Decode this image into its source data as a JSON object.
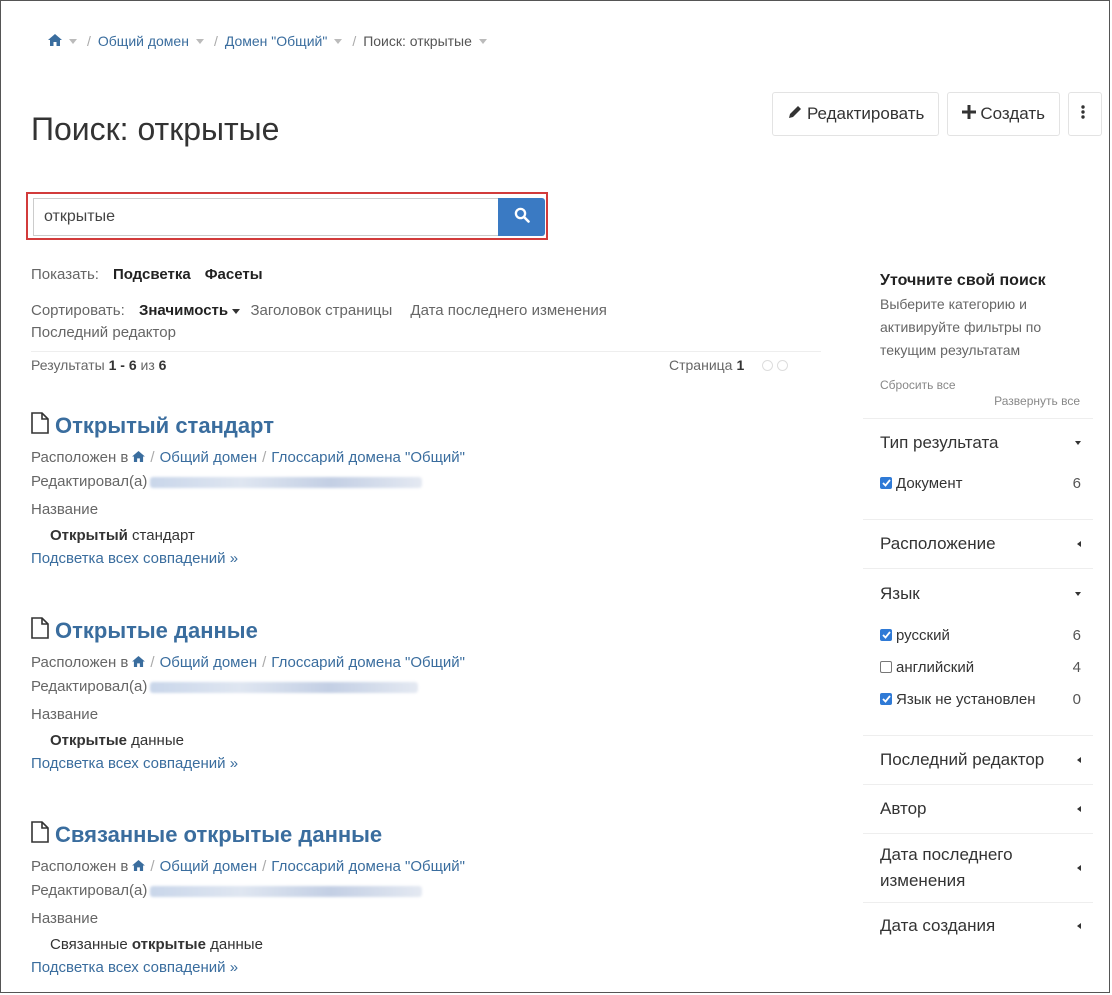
{
  "breadcrumb": {
    "home_icon": "home-icon",
    "items": [
      "Общий домен",
      "Домен \"Общий\""
    ],
    "current": "Поиск: открытые"
  },
  "page": {
    "title": "Поиск: открытые"
  },
  "toolbar": {
    "edit_label": "Редактировать",
    "create_label": "Создать",
    "more_icon": "vertical-dots-icon"
  },
  "search": {
    "value": "открытые",
    "button_icon": "search-icon",
    "highlight_color": "#d23b3b"
  },
  "show": {
    "label": "Показать:",
    "options": [
      "Подсветка",
      "Фасеты"
    ]
  },
  "sort": {
    "label": "Сортировать:",
    "selected": "Значимость",
    "options": [
      "Заголовок страницы",
      "Дата последнего изменения",
      "Последний редактор"
    ]
  },
  "results_summary": {
    "prefix": "Результаты",
    "range": "1 - 6",
    "of": "из",
    "total": "6"
  },
  "pagination": {
    "label": "Страница",
    "current": "1"
  },
  "results": [
    {
      "title": "Открытый стандарт",
      "located_label": "Расположен в",
      "path": [
        "Общий домен",
        "Глоссарий домена \"Общий\""
      ],
      "edited_label": "Редактировал(а)",
      "field_label": "Название",
      "snippet_bold": "Открытый",
      "snippet_rest": " стандарт",
      "snippet_prefix": "",
      "highlight_link": "Подсветка всех совпадений »"
    },
    {
      "title": "Открытые данные",
      "located_label": "Расположен в",
      "path": [
        "Общий домен",
        "Глоссарий домена \"Общий\""
      ],
      "edited_label": "Редактировал(а)",
      "field_label": "Название",
      "snippet_bold": "Открытые",
      "snippet_rest": " данные",
      "snippet_prefix": "",
      "highlight_link": "Подсветка всех совпадений »"
    },
    {
      "title": "Связанные открытые данные",
      "located_label": "Расположен в",
      "path": [
        "Общий домен",
        "Глоссарий домена \"Общий\""
      ],
      "edited_label": "Редактировал(а)",
      "field_label": "Название",
      "snippet_prefix": "Связанные ",
      "snippet_bold": "открытые",
      "snippet_rest": " данные",
      "highlight_link": "Подсветка всех совпадений »"
    }
  ],
  "sidebar": {
    "title": "Уточните свой поиск",
    "description": "Выберите категорию и активируйте фильтры по текущим результатам",
    "reset_all": "Сбросить все",
    "expand_all": "Развернуть все",
    "facets": {
      "result_type": {
        "label": "Тип результата",
        "items": [
          {
            "label": "Документ",
            "count": "6",
            "checked": true
          }
        ]
      },
      "location": {
        "label": "Расположение"
      },
      "language": {
        "label": "Язык",
        "items": [
          {
            "label": "русский",
            "count": "6",
            "checked": true
          },
          {
            "label": "английский",
            "count": "4",
            "checked": false
          },
          {
            "label": "Язык не установлен",
            "count": "0",
            "checked": true
          }
        ]
      },
      "last_editor": {
        "label": "Последний редактор"
      },
      "author": {
        "label": "Автор"
      },
      "last_modified": {
        "label": "Дата последнего изменения"
      },
      "created": {
        "label": "Дата создания"
      }
    }
  },
  "colors": {
    "link": "#3a6d9e",
    "primary_button": "#3a7ac3",
    "checkbox": "#2f7ad6"
  }
}
